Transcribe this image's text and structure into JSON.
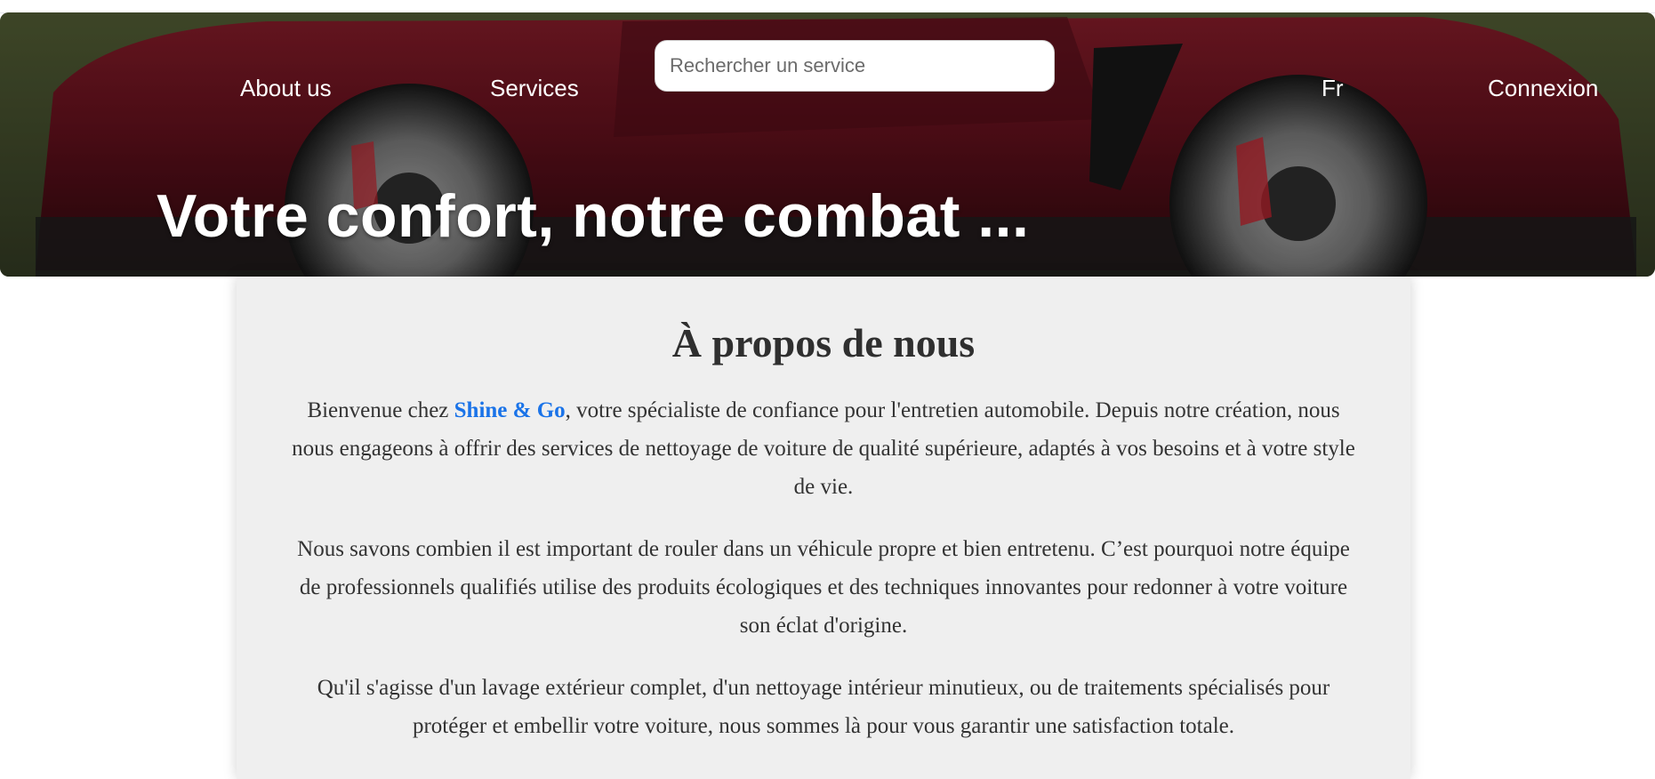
{
  "header": {
    "nav": {
      "about": "About us",
      "services": "Services",
      "language": "Fr",
      "login": "Connexion"
    },
    "search": {
      "placeholder": "Rechercher un service",
      "value": ""
    },
    "hero_title": "Votre confort, notre combat ..."
  },
  "about": {
    "heading": "À propos de nous",
    "paragraph1": {
      "before": "Bienvenue chez ",
      "brand": "Shine & Go",
      "after": ", votre spécialiste de confiance pour l'entretien automobile. Depuis notre création, nous nous engageons à offrir des services de nettoyage de voiture de qualité supérieure, adaptés à vos besoins et à votre style de vie."
    },
    "paragraph2": "Nous savons combien il est important de rouler dans un véhicule propre et bien entretenu. C’est pourquoi notre équipe de professionnels qualifiés utilise des produits écologiques et des techniques innovantes pour redonner à votre voiture son éclat d'origine.",
    "paragraph3": "Qu'il s'agisse d'un lavage extérieur complet, d'un nettoyage intérieur minutieux, ou de traitements spécialisés pour protéger et embellir votre voiture, nous sommes là pour vous garantir une satisfaction totale."
  },
  "colors": {
    "brand": "#1a73e8",
    "content_bg": "#efefef",
    "car_red": "#6e1420"
  }
}
